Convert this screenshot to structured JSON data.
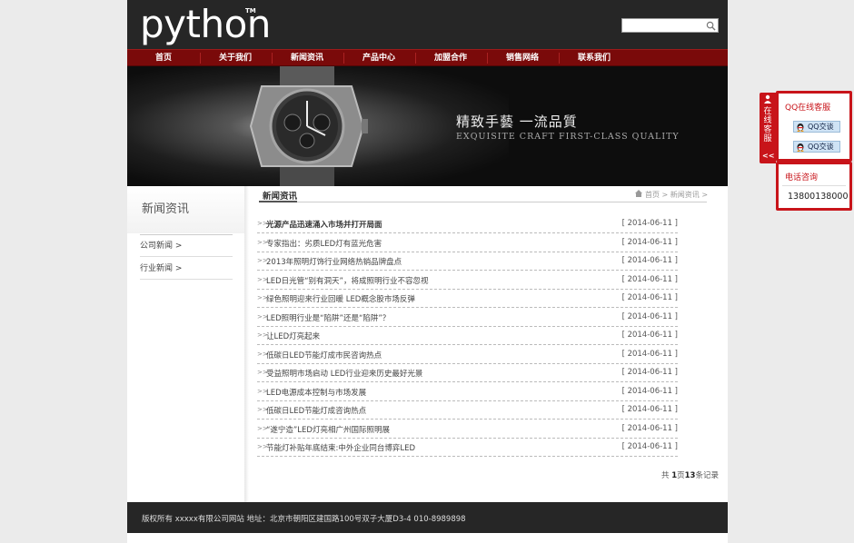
{
  "header": {
    "logo": "python",
    "logo_tm": "TM",
    "search_placeholder": ""
  },
  "nav": {
    "items": [
      "首页",
      "关于我们",
      "新闻资讯",
      "产品中心",
      "加盟合作",
      "销售网络",
      "联系我们"
    ]
  },
  "banner": {
    "slogan_cn": "精致手藝 一流品質",
    "slogan_en": "EXQUISITE CRAFT FIRST-CLASS QUALITY"
  },
  "sidebar": {
    "title": "新闻资讯",
    "items": [
      {
        "label": "公司新闻  >"
      },
      {
        "label": "行业新闻  >"
      }
    ]
  },
  "main": {
    "section_title": "新闻资讯",
    "breadcrumb": "首页 > 新闻资讯 >",
    "news": [
      {
        "title": "光源产品迅速涌入市场并打开局面",
        "date": "[ 2014-06-11 ]"
      },
      {
        "title": "专家指出：劣质LED灯有蓝光危害",
        "date": "[ 2014-06-11 ]"
      },
      {
        "title": "2013年照明灯饰行业网络热销品牌盘点",
        "date": "[ 2014-06-11 ]"
      },
      {
        "title": "LED日光管“别有洞天”，将成照明行业不容忽视",
        "date": "[ 2014-06-11 ]"
      },
      {
        "title": "绿色照明迎来行业回暖 LED概念股市场反弹",
        "date": "[ 2014-06-11 ]"
      },
      {
        "title": "LED照明行业是“陷阱”还是“陷阱”？",
        "date": "[ 2014-06-11 ]"
      },
      {
        "title": "让LED灯亮起来",
        "date": "[ 2014-06-11 ]"
      },
      {
        "title": "低碳日LED节能灯成市民咨询热点",
        "date": "[ 2014-06-11 ]"
      },
      {
        "title": "受益照明市场启动 LED行业迎来历史最好光景",
        "date": "[ 2014-06-11 ]"
      },
      {
        "title": "LED电源成本控制与市场发展",
        "date": "[ 2014-06-11 ]"
      },
      {
        "title": "低碳日LED节能灯成咨询热点",
        "date": "[ 2014-06-11 ]"
      },
      {
        "title": "“遂宁造”LED灯亮相广州国际照明展",
        "date": "[ 2014-06-11 ]"
      },
      {
        "title": "节能灯补贴年底结束:中外企业同台博弈LED",
        "date": "[ 2014-06-11 ]"
      }
    ],
    "pager_prefix": "共 ",
    "pager_pages": "1",
    "pager_mid": "页",
    "pager_count": "13",
    "pager_suffix": "条记录"
  },
  "footer": {
    "text": "版权所有 xxxxx有限公司网站 地址：北京市朝阳区建国路100号双子大厦D3-4 010-8989898"
  },
  "service": {
    "tab_text": "在线客服",
    "tab_close": "<<",
    "qq_title": "QQ在线客服",
    "qq_buttons": [
      "QQ交谈",
      "QQ交谈"
    ],
    "tel_title": "电话咨询",
    "tel_number": "13800138000"
  },
  "colors": {
    "nav_bg": "#7a0a0a",
    "header_bg": "#262626",
    "accent": "#c8141a"
  }
}
